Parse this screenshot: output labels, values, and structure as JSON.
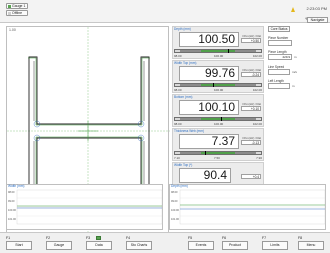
{
  "header": {
    "buttons": [
      {
        "label": "Gauge 1"
      },
      {
        "label": "Offline"
      }
    ],
    "clock": "2:23:03 PM",
    "nav_label": "Navigate"
  },
  "profile_panel": {
    "label": "1.00"
  },
  "gauges": [
    {
      "name": "Depth (mm)",
      "unit": "Ohm(Hz) ±Val",
      "value": "100.50",
      "delta": "+0.50",
      "scale_min": "98.00",
      "scale_mid": "100.00",
      "scale_max": "102.00",
      "marker_position": 0.62
    },
    {
      "name": "Width Top (mm)",
      "unit": "Ohm(Hz) ±Val",
      "value": "99.76",
      "delta": "-0.24",
      "scale_min": "98.00",
      "scale_mid": "100.00",
      "scale_max": "102.00",
      "marker_position": 0.44
    },
    {
      "name": "Bottom (mm)",
      "unit": "Ohm(Hz) ±Val",
      "value": "100.10",
      "delta": "+0.10",
      "scale_min": "98.00",
      "scale_mid": "100.00",
      "scale_max": "102.00",
      "marker_position": 0.53
    },
    {
      "name": "Thickness Web (mm)",
      "unit": "Ohm(Hz) ±Val",
      "value": "7.37",
      "delta": "-0.13",
      "scale_min": "7.10",
      "scale_mid": "7.50",
      "scale_max": "7.90",
      "marker_position": 0.35
    },
    {
      "name": "Width Top (*)",
      "unit": "",
      "value": "90.4",
      "delta": "+0.4",
      "scale_min": "89.0",
      "scale_mid": "90.0",
      "scale_max": "91.0",
      "marker_position": 0.7
    }
  ],
  "side": {
    "cs_label": "Core Status",
    "piece_number_label": "Piece Number",
    "piece_number": "",
    "piece_length_label": "Piece Length",
    "piece_length": "229.9",
    "piece_length_unit": "m",
    "line_speed_label": "Line Speed",
    "line_speed": "",
    "line_speed_unit": "m/s",
    "left_length_label": "Left Length",
    "left_length": "",
    "left_length_unit": "m"
  },
  "trends": [
    {
      "name": "Width (mm)",
      "y_top": "98.00",
      "y_mid": "99.00",
      "y_low": "100.00",
      "y_bot": "101.00"
    },
    {
      "name": "Depth (mm)",
      "y_top": "98.00",
      "y_mid": "99.00",
      "y_low": "100.00",
      "y_bot": "101.00"
    }
  ],
  "function_keys": [
    {
      "key": "F1",
      "label": "Start"
    },
    {
      "key": "F2",
      "label": "Gauge"
    },
    {
      "key": "F3",
      "label": "Data"
    },
    {
      "key": "F4",
      "label": "Sto Charts"
    },
    {
      "key": "F5",
      "label": "Events"
    },
    {
      "key": "F6",
      "label": "Product"
    },
    {
      "key": "F7",
      "label": "Limits"
    },
    {
      "key": "F8",
      "label": "Menu"
    }
  ]
}
